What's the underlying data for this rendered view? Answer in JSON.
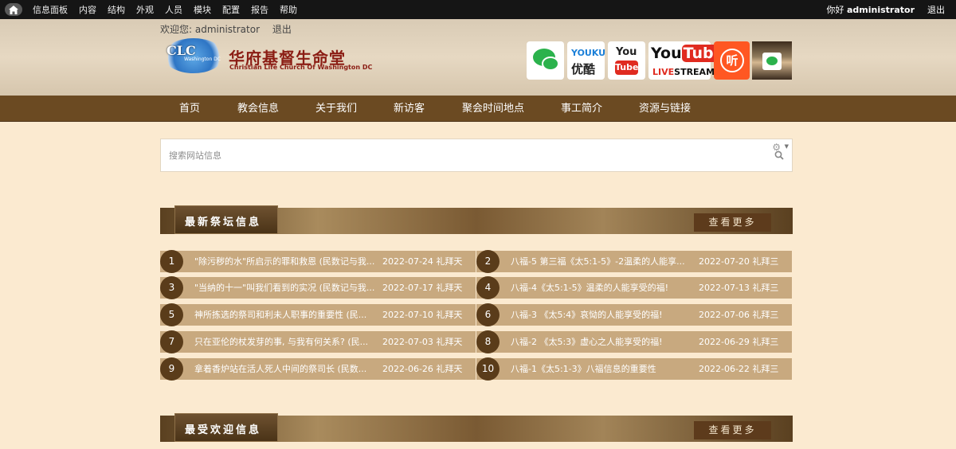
{
  "admin_bar": {
    "menu": [
      "信息面板",
      "内容",
      "结构",
      "外观",
      "人员",
      "模块",
      "配置",
      "报告",
      "帮助"
    ],
    "greeting": "你好",
    "username": "administrator",
    "logout": "退出"
  },
  "header": {
    "welcome": "欢迎您: administrator",
    "logout": "退出",
    "logo_ctc": "CLC",
    "logo_wdc": "Washington DC",
    "logo_cn": "华府基督生命堂",
    "logo_en": "Christian Life Church Of Washington DC",
    "social": {
      "youku_en": "YOUKU",
      "youku_cn": "优酷",
      "youtube_top": "You",
      "youtube_bottom": "Tube",
      "yt_live_you": "You",
      "yt_live_tube": "Tube",
      "yt_live_live": "LIVE",
      "yt_live_stream": "STREAM",
      "listen": "听"
    }
  },
  "nav": [
    "首页",
    "教会信息",
    "关于我们",
    "新访客",
    "聚会时间地点",
    "事工简介",
    "资源与链接"
  ],
  "search": {
    "placeholder": "搜索网站信息"
  },
  "sections": [
    {
      "title": "最新祭坛信息",
      "more": "查看更多"
    },
    {
      "title": "最受欢迎信息",
      "more": "查看更多"
    }
  ],
  "latest": [
    {
      "n": "1",
      "title": "\"除污秽的水\"所启示的罪和救恩 (民数记与我...",
      "date": "2022-07-24 礼拜天"
    },
    {
      "n": "2",
      "title": "八福-5 第三福《太5:1-5》-2温柔的人能享...",
      "date": "2022-07-20 礼拜三"
    },
    {
      "n": "3",
      "title": "\"当纳的十一\"叫我们看到的实况 (民数记与我...",
      "date": "2022-07-17 礼拜天"
    },
    {
      "n": "4",
      "title": "八福-4《太5:1-5》温柔的人能享受的福!",
      "date": "2022-07-13 礼拜三"
    },
    {
      "n": "5",
      "title": "神所拣选的祭司和利未人职事的重要性 (民...",
      "date": "2022-07-10 礼拜天"
    },
    {
      "n": "6",
      "title": "八福-3 《太5:4》哀恸的人能享受的福!",
      "date": "2022-07-06 礼拜三"
    },
    {
      "n": "7",
      "title": "只在亚伦的杖发芽的事, 与我有何关系? (民...",
      "date": "2022-07-03 礼拜天"
    },
    {
      "n": "8",
      "title": "八福-2 《太5:3》虚心之人能享受的福!",
      "date": "2022-06-29 礼拜三"
    },
    {
      "n": "9",
      "title": "拿着香炉站在活人死人中间的祭司长 (民数...",
      "date": "2022-06-26 礼拜天"
    },
    {
      "n": "10",
      "title": "八福-1《太5:1-3》八福信息的重要性",
      "date": "2022-06-22 礼拜三"
    }
  ]
}
